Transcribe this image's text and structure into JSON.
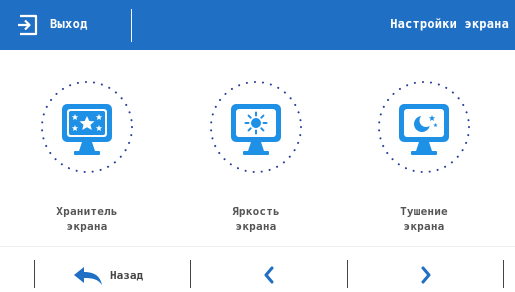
{
  "header": {
    "exit_label": "Выход",
    "title": "Настройки экрана"
  },
  "tiles": [
    {
      "line1": "Хранитель",
      "line2": "экрана",
      "icon": "screensaver-stars-icon"
    },
    {
      "line1": "Яркость",
      "line2": "экрана",
      "icon": "brightness-sun-icon"
    },
    {
      "line1": "Тушение",
      "line2": "экрана",
      "icon": "dimming-moon-icon"
    }
  ],
  "footer": {
    "back_label": "Назад",
    "prev_icon": "chevron-left-icon",
    "next_icon": "chevron-right-icon"
  },
  "colors": {
    "accent": "#1f6fc4",
    "icon_blue": "#1e90e6",
    "dots": "#2a3f9a"
  }
}
